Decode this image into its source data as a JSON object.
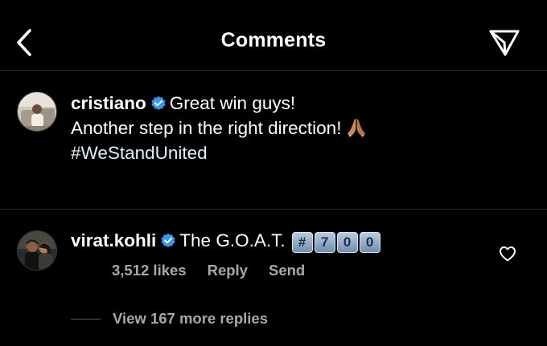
{
  "header": {
    "title": "Comments"
  },
  "caption": {
    "username": "cristiano",
    "line1": "Great win guys!",
    "line2": "Another step in the right direction!",
    "hashtag": "#WeStandUnited"
  },
  "comment": {
    "username": "virat.kohli",
    "text": "The G.O.A.T.",
    "keycaps": [
      "#",
      "7",
      "0",
      "0"
    ],
    "likes": "3,512 likes",
    "reply_label": "Reply",
    "send_label": "Send"
  },
  "replies": {
    "label": "View 167 more replies"
  },
  "icons": {
    "back": "chevron-left-icon",
    "send": "paper-plane-icon",
    "verified": "verified-badge-icon",
    "like": "heart-outline-icon",
    "emoji": "folded-hands-emoji"
  },
  "colors": {
    "background": "#000000",
    "text": "#ffffff",
    "secondary_text": "#a8a8a8",
    "verified_badge": "#3897f0",
    "divider": "#262626"
  }
}
